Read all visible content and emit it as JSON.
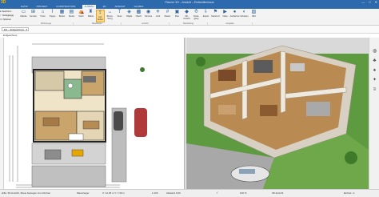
{
  "app": {
    "logo": "3D",
    "window_title": "Planner 5D – Ansicht – Einfamilienhaus",
    "controls": [
      "—",
      "□",
      "✕"
    ]
  },
  "ribbon_tabs": [
    "DATEI",
    "PROJEKT",
    "KONSTRUKTION",
    "AUSBAU",
    "3D",
    "ANSICHT",
    "GLOBAL"
  ],
  "ribbon": {
    "quick": [
      "Speichern",
      "Rückgängig",
      "Optionen"
    ],
    "buttons": [
      "Wände",
      "Fenster",
      "Türen",
      "Treppe",
      "Boden",
      "Decke",
      "Dach",
      "Möbel",
      "Auf-heben",
      "Bema-ßung",
      "Texte",
      "Objekt",
      "Oberfl.",
      "Kamera",
      "Licht",
      "Raster",
      "Plan",
      "3D-Ansicht",
      "Rund-gang",
      "Export",
      "Stand-ort",
      "Video",
      "Aufnahme",
      "Schatten",
      "Bild"
    ],
    "selected_button": "Auf-heben",
    "groups": [
      "Werkzeuge",
      "Bearbeiten",
      "Ansicht",
      "Darstellung",
      "Ausgabe"
    ]
  },
  "subbar": {
    "floor_select": "EG – Erdgeschoss",
    "floor_tab": "Erdgeschoss"
  },
  "icons": {
    "sidebar": [
      "globe-icon",
      "tree-icon",
      "chair-icon",
      "lamp-icon",
      "layers-icon"
    ]
  },
  "colors": {
    "titlebar": "#2c69ad",
    "ribbon_bg": "#f3f3f3",
    "selected": "#fbd98a",
    "floor": "#c9a56c",
    "grass": "#5e9a3f",
    "sky": "#d9d9d9"
  },
  "status": {
    "left": "Hilfe: 3D Ansicht, Maus bewegen zum Drehen",
    "tool": "Mauszeiger",
    "coords": "X: 12,45 m  Y: 7,30 m",
    "scale": "1:100",
    "measure": "Abstand 0,00",
    "zoom": "100 %",
    "mode": "3D Ansicht",
    "right": "Einheit: m"
  }
}
